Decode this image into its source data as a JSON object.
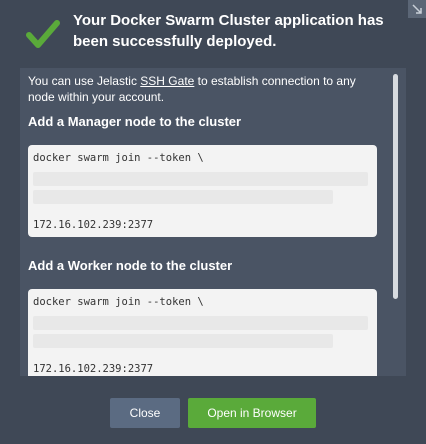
{
  "dialog": {
    "title": "Your Docker Swarm Cluster application has been successfully deployed.",
    "icons": {
      "success": "checkmark-icon",
      "corner": "resize-corner-icon"
    },
    "colors": {
      "background": "#3f4856",
      "panel": "#4a5464",
      "success": "#5aaa3a",
      "close": "#5b6b82"
    }
  },
  "body": {
    "intro_before": "You can use Jelastic ",
    "intro_link": "SSH Gate",
    "intro_after": " to establish connection to any node within your account.",
    "manager": {
      "heading": "Add a Manager node to the cluster",
      "command_line1": "docker swarm join --token \\",
      "command_line3": "172.16.102.239:2377"
    },
    "worker": {
      "heading": "Add a Worker node to the cluster",
      "command_line1": "docker swarm join --token \\",
      "command_line3": "172.16.102.239:2377"
    }
  },
  "footer": {
    "close_label": "Close",
    "open_label": "Open in Browser"
  }
}
